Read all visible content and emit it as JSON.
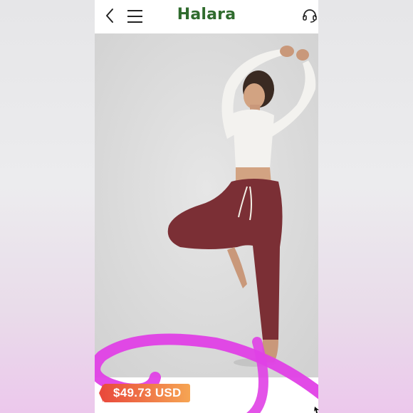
{
  "header": {
    "brand": "Halara",
    "icons": [
      "back-chevron-icon",
      "hamburger-menu-icon",
      "headset-support-icon"
    ]
  },
  "product": {
    "price": "$49.73 USD"
  },
  "colors": {
    "brand_green": "#2f6b2d",
    "badge_start": "#e94b3c",
    "badge_end": "#f6a553",
    "swirl": "#e040e6",
    "pants": "#7b2f35"
  }
}
